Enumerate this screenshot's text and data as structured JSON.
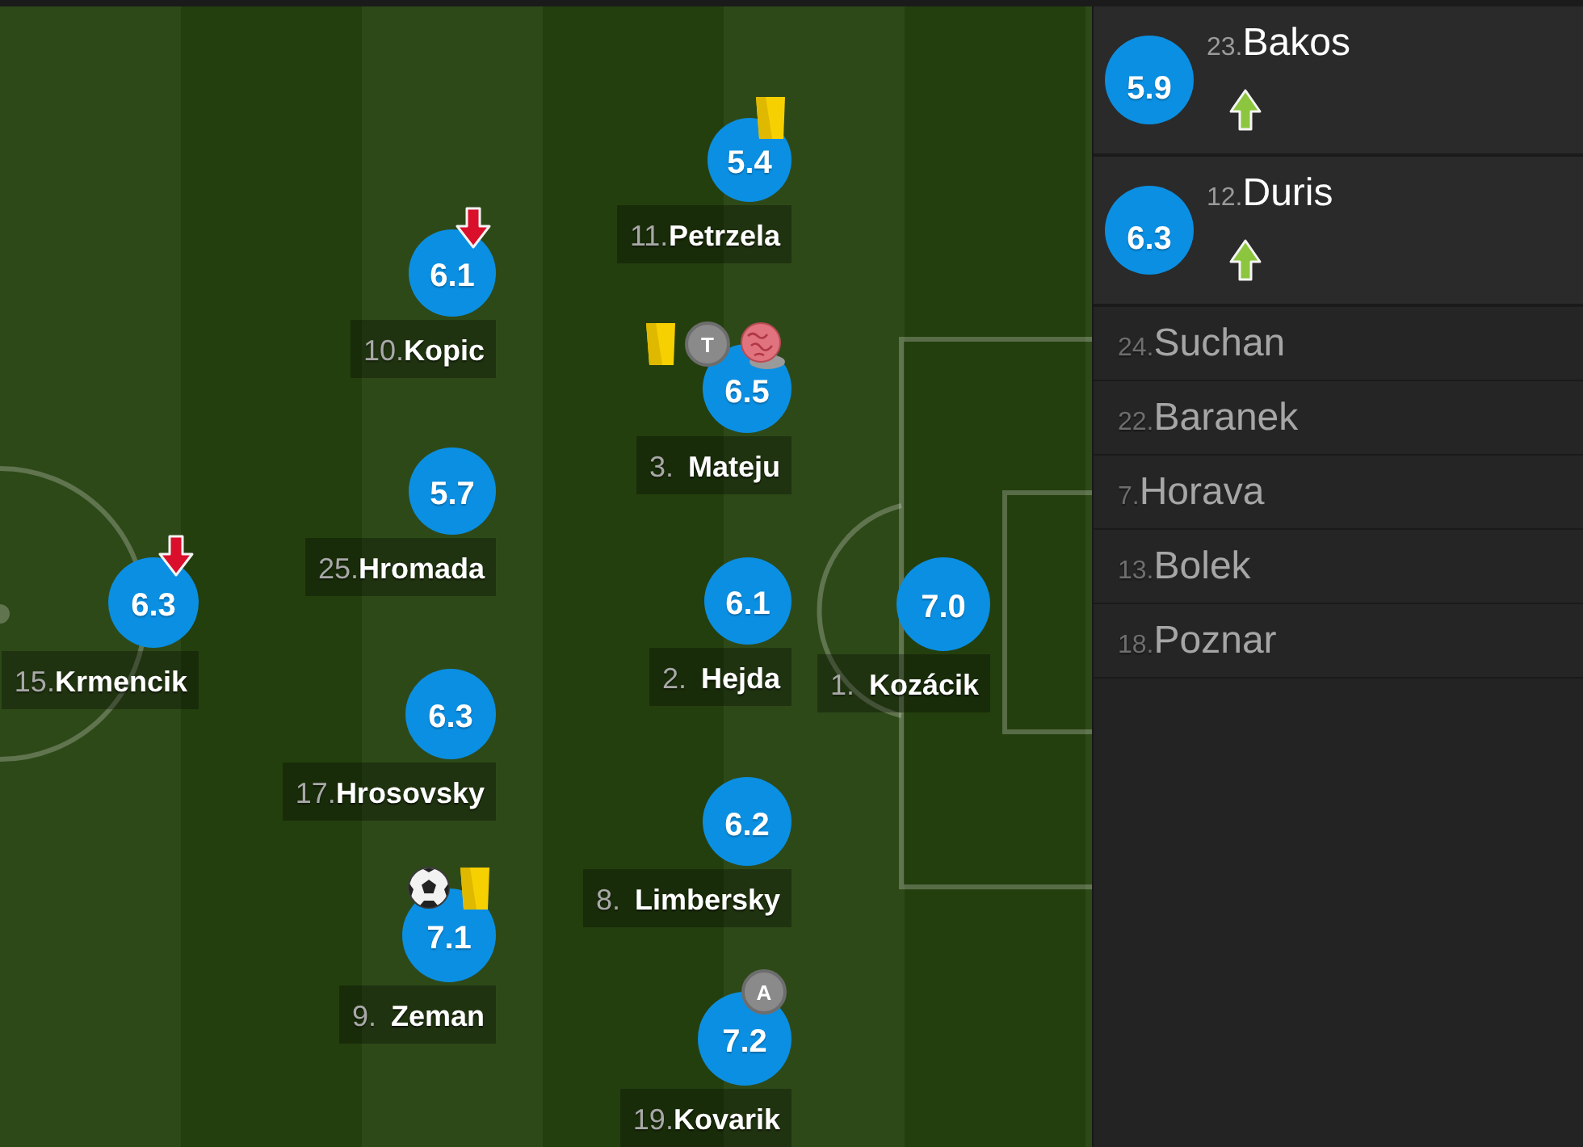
{
  "pitch": {
    "players": [
      {
        "number": "11.",
        "name": "Petrzela",
        "rating": "5.4",
        "events": [
          {
            "kind": "yellow_card"
          }
        ]
      },
      {
        "number": "10.",
        "name": "Kopic",
        "rating": "6.1",
        "events": [
          {
            "kind": "sub_off"
          }
        ]
      },
      {
        "number": "3.",
        "name": "Mateju",
        "rating": "6.5",
        "events": [
          {
            "kind": "yellow_card"
          },
          {
            "kind": "letter",
            "text": "T"
          },
          {
            "kind": "own_goal"
          }
        ]
      },
      {
        "number": "25.",
        "name": "Hromada",
        "rating": "5.7"
      },
      {
        "number": "15.",
        "name": "Krmencik",
        "rating": "6.3",
        "events": [
          {
            "kind": "sub_off"
          }
        ]
      },
      {
        "number": "2.",
        "name": "Hejda",
        "rating": "6.1"
      },
      {
        "number": "1.",
        "name": "Kozácik",
        "rating": "7.0"
      },
      {
        "number": "17.",
        "name": "Hrosovsky",
        "rating": "6.3"
      },
      {
        "number": "8.",
        "name": "Limbersky",
        "rating": "6.2"
      },
      {
        "number": "9.",
        "name": "Zeman",
        "rating": "7.1",
        "events": [
          {
            "kind": "goal"
          },
          {
            "kind": "yellow_card"
          }
        ]
      },
      {
        "number": "19.",
        "name": "Kovarik",
        "rating": "7.2",
        "events": [
          {
            "kind": "letter",
            "text": "A"
          }
        ]
      }
    ]
  },
  "substitutes": [
    {
      "number": "23.",
      "name": "Bakos",
      "played": true,
      "rating": "5.9",
      "events": [
        {
          "kind": "sub_on"
        }
      ]
    },
    {
      "number": "12.",
      "name": "Duris",
      "played": true,
      "rating": "6.3",
      "events": [
        {
          "kind": "sub_on"
        }
      ]
    },
    {
      "number": "24.",
      "name": "Suchan",
      "played": false
    },
    {
      "number": "22.",
      "name": "Baranek",
      "played": false
    },
    {
      "number": "7.",
      "name": "Horava",
      "played": false
    },
    {
      "number": "13.",
      "name": "Bolek",
      "played": false
    },
    {
      "number": "18.",
      "name": "Poznar",
      "played": false
    }
  ]
}
